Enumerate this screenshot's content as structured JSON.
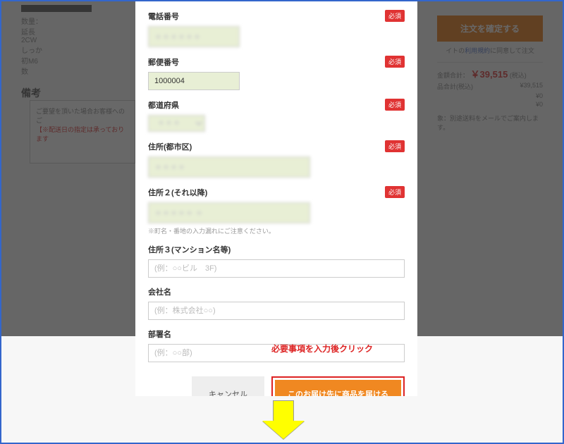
{
  "background": {
    "specs": [
      "数量：",
      "延長",
      "2CW",
      "しっか",
      "初M6",
      "数"
    ],
    "remark_title": "備考",
    "remark_note1": "ご要望を頂いた場合お客様へのご",
    "remark_note2": "【※配送日の指定は承っております",
    "confirm_button": "注文を確定する",
    "agree_prefix": "イトの",
    "agree_link": "利用規約",
    "agree_suffix": "に同意して注文",
    "total_label": "金額合計：",
    "total_value": "￥39,515",
    "total_tax": "(税込)",
    "rows": [
      {
        "label": "品合計(税込)",
        "value": "¥39,515"
      },
      {
        "label": "",
        "value": "¥0"
      },
      {
        "label": "",
        "value": "¥0"
      }
    ],
    "shipping_note": "象：別途送料をメールでご案内します。"
  },
  "form": {
    "phone": {
      "label": "電話番号",
      "required": "必須",
      "value": "＊＊＊＊＊＊"
    },
    "postal": {
      "label": "郵便番号",
      "required": "必須",
      "value": "1000004"
    },
    "pref": {
      "label": "都道府県",
      "required": "必須",
      "value": "＊＊＊"
    },
    "city": {
      "label": "住所(都市区)",
      "required": "必須",
      "value": "＊＊＊＊"
    },
    "addr2": {
      "label": "住所２(それ以降)",
      "required": "必須",
      "value": "＊＊＊＊＊ ＊",
      "hint": "※町名・番地の入力漏れにご注意ください。"
    },
    "addr3": {
      "label": "住所３(マンション名等)",
      "placeholder": "(例：○○ビル　3F)"
    },
    "company": {
      "label": "会社名",
      "placeholder": "(例：株式会社○○)"
    },
    "dept": {
      "label": "部署名",
      "placeholder": "(例：○○部)"
    }
  },
  "buttons": {
    "cancel": "キャンセル",
    "submit": "このお届け先に商品を届ける"
  },
  "callout": "必要事項を入力後クリック"
}
